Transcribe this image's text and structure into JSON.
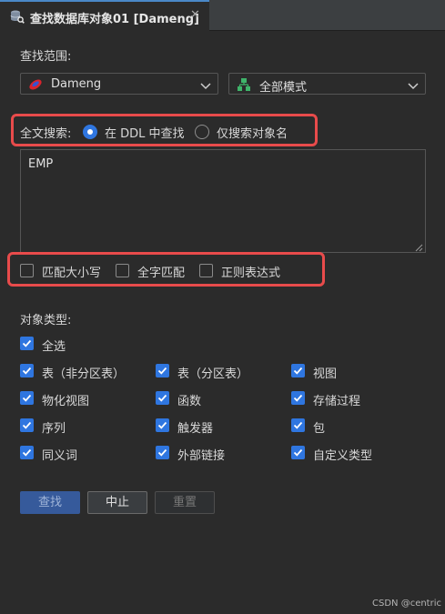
{
  "tab": {
    "title": "查找数据库对象01 [Dameng]",
    "close": "✕",
    "icon": "database-search-icon"
  },
  "scope": {
    "label": "查找范围:",
    "datasource": {
      "value": "Dameng",
      "icon": "dameng-icon"
    },
    "schema": {
      "value": "全部模式",
      "icon": "schema-icon"
    }
  },
  "fulltext": {
    "label": "全文搜索:",
    "options": [
      "在 DDL 中查找",
      "仅搜索对象名"
    ],
    "selected": "在 DDL 中查找"
  },
  "query": {
    "value": "EMP"
  },
  "match": {
    "case": {
      "label": "匹配大小写",
      "checked": false
    },
    "whole_word": {
      "label": "全字匹配",
      "checked": false
    },
    "regex": {
      "label": "正则表达式",
      "checked": false
    }
  },
  "object_types": {
    "label": "对象类型:",
    "select_all": {
      "label": "全选",
      "checked": true
    },
    "items": [
      {
        "label": "表（非分区表）",
        "checked": true
      },
      {
        "label": "表（分区表）",
        "checked": true
      },
      {
        "label": "视图",
        "checked": true
      },
      {
        "label": "物化视图",
        "checked": true
      },
      {
        "label": "函数",
        "checked": true
      },
      {
        "label": "存储过程",
        "checked": true
      },
      {
        "label": "序列",
        "checked": true
      },
      {
        "label": "触发器",
        "checked": true
      },
      {
        "label": "包",
        "checked": true
      },
      {
        "label": "同义词",
        "checked": true
      },
      {
        "label": "外部链接",
        "checked": true
      },
      {
        "label": "自定义类型",
        "checked": true
      }
    ]
  },
  "buttons": {
    "search": "查找",
    "stop": "中止",
    "reset": "重置"
  },
  "footer": "CSDN @centric",
  "colors": {
    "accent": "#2f76e0",
    "highlight": "#e84b4b",
    "background": "#2b2b2b"
  }
}
